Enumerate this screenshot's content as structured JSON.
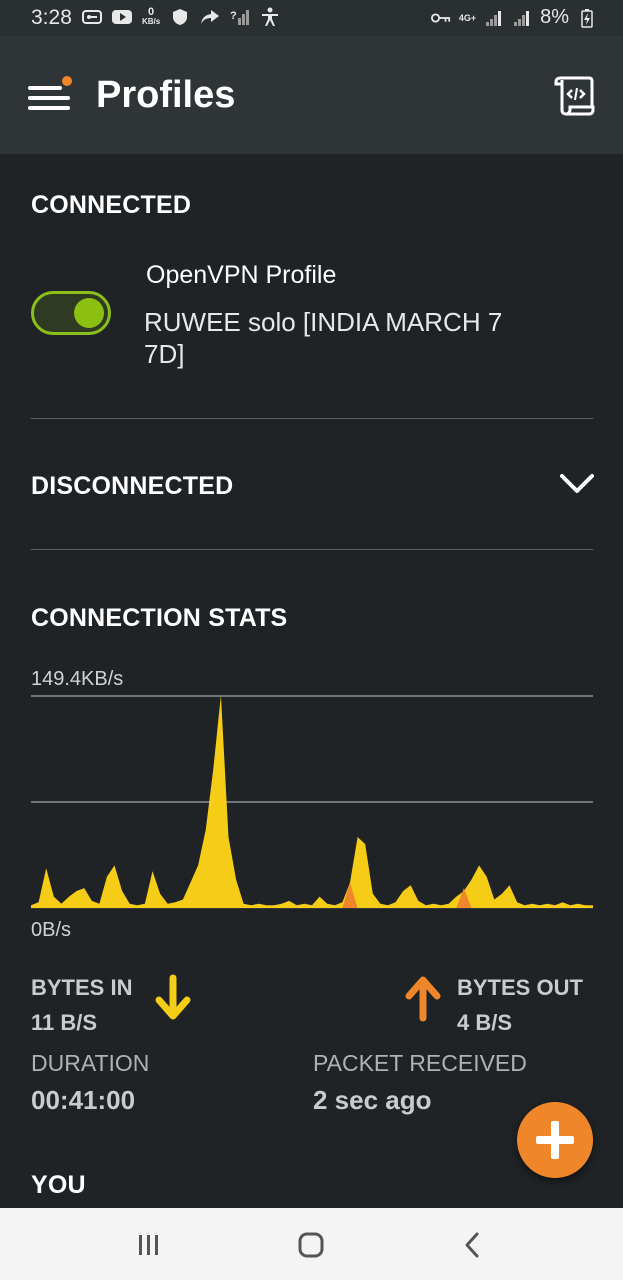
{
  "status_bar": {
    "time": "3:28",
    "speed_value": "0",
    "speed_unit": "KB/s",
    "network": "4G+",
    "battery": "8%"
  },
  "app_bar": {
    "title": "Profiles"
  },
  "connected": {
    "heading": "CONNECTED",
    "profile_type": "OpenVPN Profile",
    "profile_name": "RUWEE solo [INDIA MARCH 7 7D]",
    "toggle_on": true
  },
  "disconnected": {
    "heading": "DISCONNECTED"
  },
  "stats": {
    "heading": "CONNECTION STATS",
    "max_label": "149.4KB/s",
    "min_label": "0B/s",
    "bytes_in_label": "BYTES IN",
    "bytes_in_value": "11 B/S",
    "bytes_out_label": "BYTES OUT",
    "bytes_out_value": "4 B/S",
    "duration_label": "DURATION",
    "duration_value": "00:41:00",
    "packet_label": "PACKET RECEIVED",
    "packet_value": "2 sec ago"
  },
  "you": {
    "heading": "YOU"
  },
  "colors": {
    "background": "#1f2326",
    "app_bar": "#2f3437",
    "accent_orange": "#f0862a",
    "toggle_green": "#8cc010",
    "graph_yellow": "#f5cc16"
  },
  "chart_data": {
    "type": "area",
    "ylim": [
      0,
      149.4
    ],
    "series": [
      {
        "values": [
          2,
          4,
          28,
          8,
          3,
          8,
          12,
          14,
          5,
          3,
          22,
          30,
          12,
          3,
          2,
          3,
          26,
          10,
          3,
          4,
          6,
          18,
          30,
          55,
          98,
          150,
          50,
          20,
          3,
          2,
          3,
          2,
          2,
          3,
          5,
          2,
          3,
          2,
          8,
          3,
          2,
          4,
          18,
          50,
          45,
          10,
          3,
          2,
          4,
          12,
          16,
          5,
          2,
          3,
          2,
          3,
          8,
          12,
          20,
          30,
          22,
          6,
          10,
          16,
          4,
          2,
          3,
          2,
          3,
          2,
          4,
          2,
          3,
          2,
          2
        ]
      },
      {
        "values": [
          0,
          0,
          0,
          0,
          0,
          0,
          0,
          0,
          0,
          0,
          0,
          0,
          0,
          0,
          0,
          0,
          0,
          0,
          0,
          0,
          0,
          0,
          0,
          0,
          0,
          0,
          0,
          0,
          0,
          0,
          0,
          0,
          0,
          0,
          0,
          0,
          0,
          0,
          0,
          0,
          0,
          0,
          18,
          0,
          0,
          0,
          0,
          0,
          0,
          0,
          0,
          0,
          0,
          0,
          0,
          0,
          0,
          14,
          0,
          0,
          0,
          0,
          0,
          0,
          0,
          0,
          0,
          0,
          0,
          0,
          0,
          0,
          0,
          0,
          0
        ]
      }
    ]
  }
}
